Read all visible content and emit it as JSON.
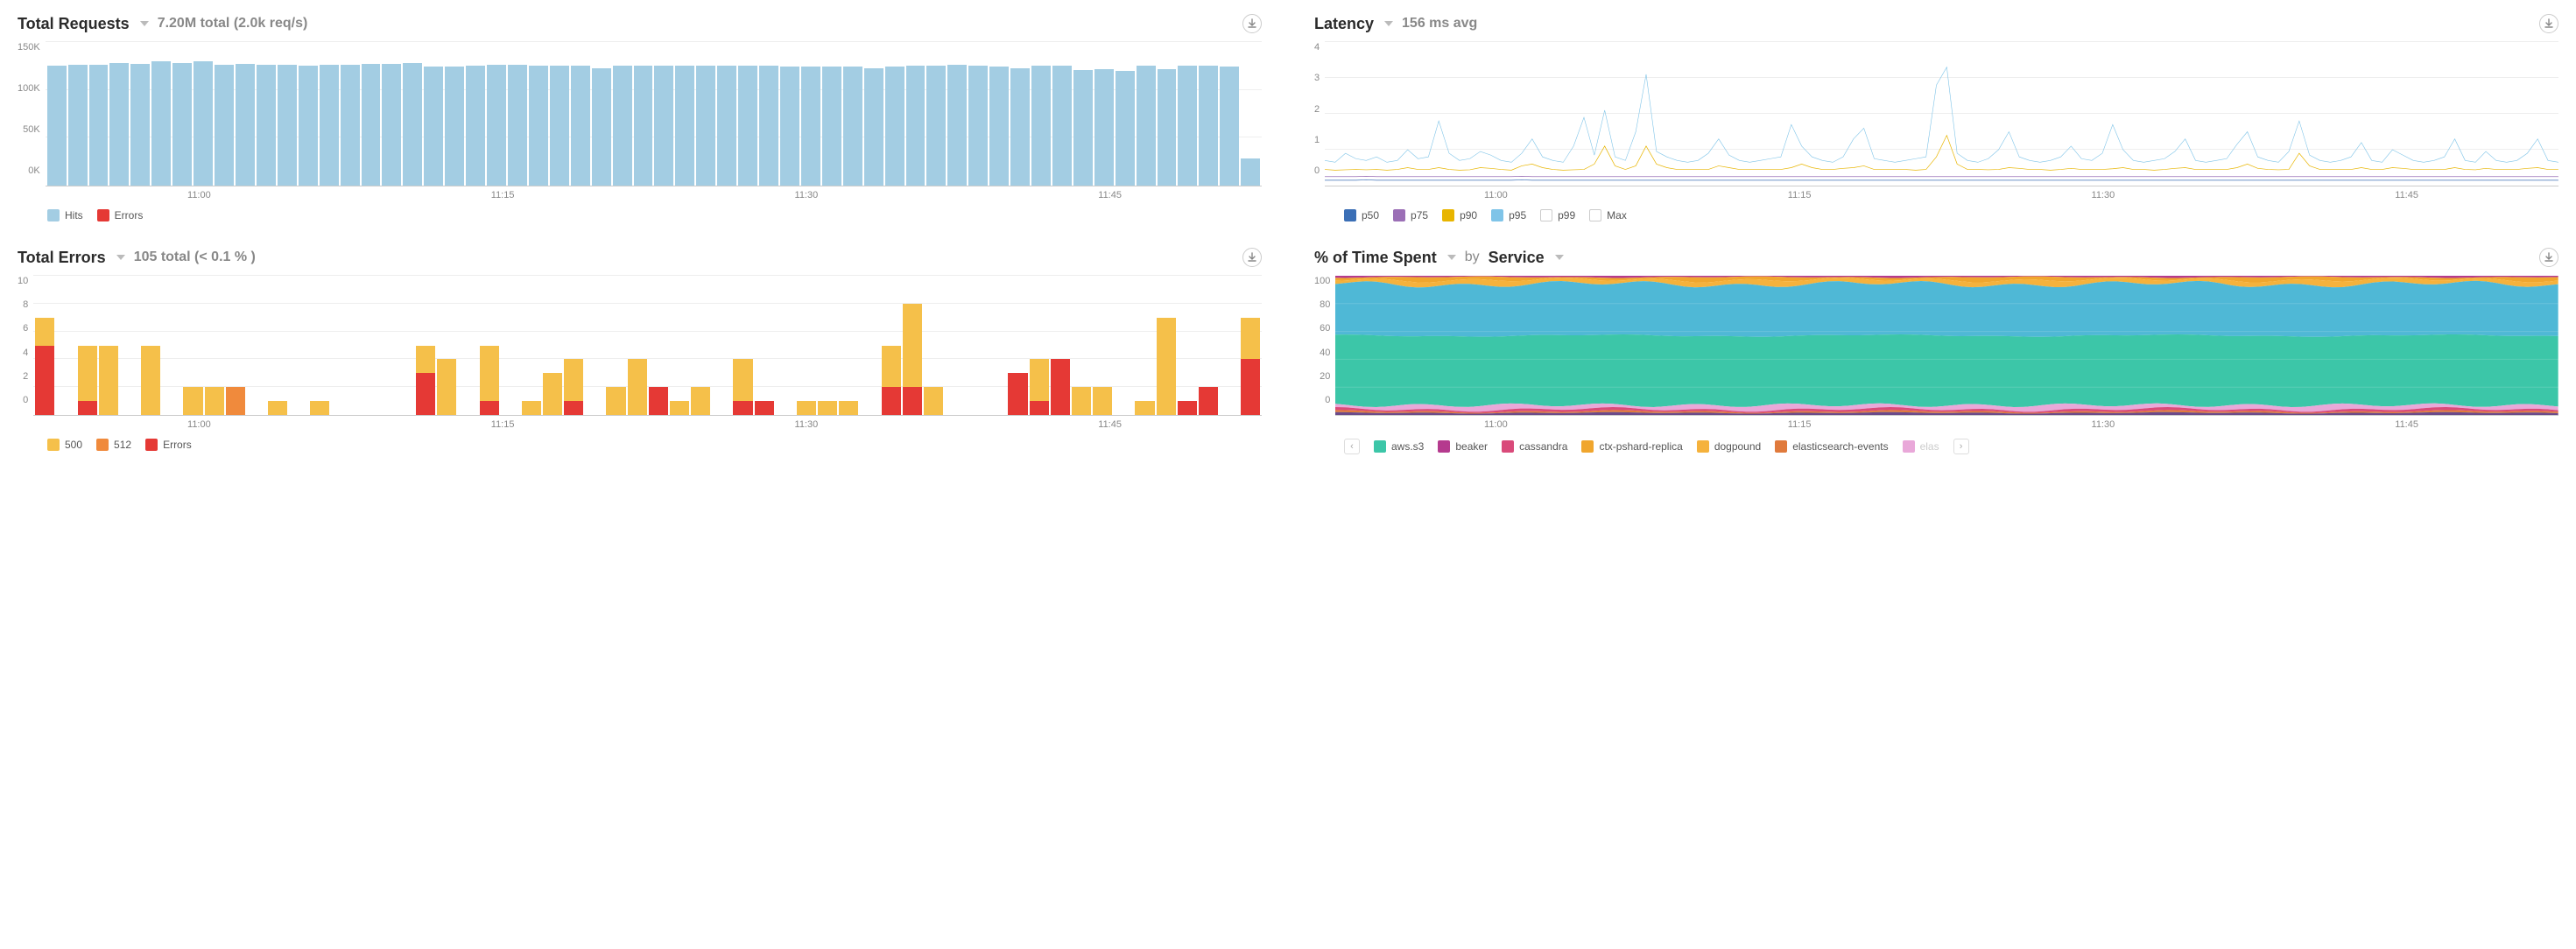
{
  "panels": {
    "requests": {
      "title": "Total Requests",
      "summary": "7.20M total (2.0k req/s)",
      "y_ticks": [
        "150K",
        "100K",
        "50K",
        "0K"
      ],
      "x_ticks": [
        "11:00",
        "11:15",
        "11:30",
        "11:45"
      ],
      "legend": [
        {
          "label": "Hits",
          "color": "#a3cde3"
        },
        {
          "label": "Errors",
          "color": "#e53935"
        }
      ]
    },
    "latency": {
      "title": "Latency",
      "summary": "156 ms avg",
      "y_ticks": [
        "4",
        "3",
        "2",
        "1",
        "0"
      ],
      "x_ticks": [
        "11:00",
        "11:15",
        "11:30",
        "11:45"
      ],
      "legend": [
        {
          "label": "p50",
          "color": "#3b6fb6"
        },
        {
          "label": "p75",
          "color": "#9b6fb6"
        },
        {
          "label": "p90",
          "color": "#e8b500"
        },
        {
          "label": "p95",
          "color": "#7fc4e8"
        },
        {
          "label": "p99",
          "color": "hollow"
        },
        {
          "label": "Max",
          "color": "hollow"
        }
      ]
    },
    "errors": {
      "title": "Total Errors",
      "summary": "105 total (< 0.1 % )",
      "y_ticks": [
        "10",
        "8",
        "6",
        "4",
        "2",
        "0"
      ],
      "x_ticks": [
        "11:00",
        "11:15",
        "11:30",
        "11:45"
      ],
      "legend": [
        {
          "label": "500",
          "color": "#f5c04a"
        },
        {
          "label": "512",
          "color": "#f08a3c"
        },
        {
          "label": "Errors",
          "color": "#e53935"
        }
      ]
    },
    "timespent": {
      "title": "% of Time Spent",
      "by_label": "by",
      "group_label": "Service",
      "y_ticks": [
        "100",
        "80",
        "60",
        "40",
        "20",
        "0"
      ],
      "x_ticks": [
        "11:00",
        "11:15",
        "11:30",
        "11:45"
      ],
      "legend": [
        {
          "label": "aws.s3",
          "color": "#3cc6a8"
        },
        {
          "label": "beaker",
          "color": "#b53a8e"
        },
        {
          "label": "cassandra",
          "color": "#d94a7a"
        },
        {
          "label": "ctx-pshard-replica",
          "color": "#f0a62e"
        },
        {
          "label": "dogpound",
          "color": "#f5b23c"
        },
        {
          "label": "elasticsearch-events",
          "color": "#e07a3c"
        },
        {
          "label": "elas",
          "color": "#e9a8d9",
          "fade": true
        }
      ]
    }
  },
  "chart_data": [
    {
      "id": "requests",
      "type": "bar",
      "title": "Total Requests",
      "subtitle": "7.20M total (2.0k req/s)",
      "xlabel": "",
      "ylabel": "",
      "ylim": [
        0,
        150000
      ],
      "x_tick_labels": [
        "11:00",
        "11:15",
        "11:30",
        "11:45"
      ],
      "n_bars": 58,
      "series": [
        {
          "name": "Hits",
          "color": "#a3cde3",
          "values": [
            125000,
            126000,
            126000,
            128000,
            127000,
            130000,
            128000,
            130000,
            126000,
            127000,
            126000,
            126000,
            125000,
            126000,
            126000,
            127000,
            127000,
            128000,
            124000,
            124000,
            125000,
            126000,
            126000,
            125000,
            125000,
            125000,
            123000,
            125000,
            125000,
            125000,
            125000,
            125000,
            125000,
            125000,
            125000,
            124000,
            124000,
            124000,
            124000,
            123000,
            124000,
            125000,
            125000,
            126000,
            125000,
            124000,
            123000,
            125000,
            125000,
            121000,
            122000,
            120000,
            125000,
            122000,
            125000,
            125000,
            124000,
            28000
          ]
        },
        {
          "name": "Errors",
          "color": "#e53935",
          "values": [
            0,
            0,
            0,
            0,
            0,
            0,
            0,
            0,
            0,
            0,
            0,
            0,
            0,
            0,
            0,
            0,
            0,
            0,
            0,
            0,
            0,
            0,
            0,
            0,
            0,
            0,
            0,
            0,
            0,
            0,
            0,
            0,
            0,
            0,
            0,
            0,
            0,
            0,
            0,
            0,
            0,
            0,
            0,
            0,
            0,
            0,
            0,
            0,
            0,
            0,
            0,
            0,
            0,
            0,
            0,
            0,
            0,
            0
          ]
        }
      ]
    },
    {
      "id": "latency",
      "type": "line",
      "title": "Latency",
      "subtitle": "156 ms avg",
      "xlabel": "",
      "ylabel": "",
      "ylim": [
        0,
        4
      ],
      "x_tick_labels": [
        "11:00",
        "11:15",
        "11:30",
        "11:45"
      ],
      "n_points": 120,
      "series": [
        {
          "name": "p50",
          "color": "#3b6fb6",
          "values": [
            0.15,
            0.15,
            0.15,
            0.15,
            0.16,
            0.15,
            0.15,
            0.15,
            0.15,
            0.15,
            0.15,
            0.15,
            0.15,
            0.15,
            0.15,
            0.15,
            0.15,
            0.15,
            0.15,
            0.16,
            0.15,
            0.15,
            0.15,
            0.15,
            0.15,
            0.15,
            0.15,
            0.15,
            0.15,
            0.15,
            0.15,
            0.15,
            0.15,
            0.15,
            0.15,
            0.15,
            0.15,
            0.15,
            0.15,
            0.15,
            0.15,
            0.15,
            0.15,
            0.15,
            0.15,
            0.15,
            0.15,
            0.15,
            0.15,
            0.15,
            0.15,
            0.15,
            0.15,
            0.15,
            0.15,
            0.15,
            0.15,
            0.15,
            0.15,
            0.15,
            0.15,
            0.15,
            0.15,
            0.15,
            0.15,
            0.15,
            0.15,
            0.15,
            0.15,
            0.15,
            0.15,
            0.15,
            0.15,
            0.15,
            0.15,
            0.15,
            0.15,
            0.15,
            0.15,
            0.15,
            0.15,
            0.15,
            0.15,
            0.15,
            0.15,
            0.15,
            0.15,
            0.15,
            0.15,
            0.15,
            0.15,
            0.15,
            0.15,
            0.15,
            0.15,
            0.15,
            0.15,
            0.15,
            0.15,
            0.15,
            0.15,
            0.15,
            0.15,
            0.15,
            0.15,
            0.15,
            0.15,
            0.15,
            0.15,
            0.15,
            0.15,
            0.15,
            0.15,
            0.15,
            0.15,
            0.15,
            0.15,
            0.15,
            0.15,
            0.15
          ]
        },
        {
          "name": "p75",
          "color": "#9b6fb6",
          "values": [
            0.25,
            0.25,
            0.25,
            0.25,
            0.26,
            0.25,
            0.25,
            0.25,
            0.25,
            0.25,
            0.25,
            0.25,
            0.25,
            0.25,
            0.25,
            0.25,
            0.25,
            0.25,
            0.25,
            0.26,
            0.25,
            0.25,
            0.25,
            0.25,
            0.25,
            0.25,
            0.25,
            0.25,
            0.25,
            0.25,
            0.25,
            0.25,
            0.25,
            0.25,
            0.25,
            0.25,
            0.25,
            0.25,
            0.25,
            0.25,
            0.25,
            0.25,
            0.25,
            0.25,
            0.25,
            0.25,
            0.25,
            0.25,
            0.25,
            0.25,
            0.25,
            0.25,
            0.25,
            0.25,
            0.25,
            0.25,
            0.25,
            0.25,
            0.25,
            0.25,
            0.25,
            0.25,
            0.25,
            0.25,
            0.25,
            0.25,
            0.25,
            0.25,
            0.25,
            0.25,
            0.25,
            0.25,
            0.25,
            0.25,
            0.25,
            0.25,
            0.25,
            0.25,
            0.25,
            0.25,
            0.25,
            0.25,
            0.25,
            0.25,
            0.25,
            0.25,
            0.25,
            0.25,
            0.25,
            0.25,
            0.25,
            0.25,
            0.25,
            0.25,
            0.25,
            0.25,
            0.25,
            0.25,
            0.25,
            0.25,
            0.25,
            0.25,
            0.25,
            0.25,
            0.25,
            0.25,
            0.25,
            0.25,
            0.25,
            0.25,
            0.25,
            0.25,
            0.25,
            0.25,
            0.25,
            0.25,
            0.25,
            0.25,
            0.25,
            0.25
          ]
        },
        {
          "name": "p90",
          "color": "#e8b500",
          "values": [
            0.45,
            0.43,
            0.44,
            0.45,
            0.44,
            0.45,
            0.43,
            0.45,
            0.5,
            0.45,
            0.45,
            0.5,
            0.45,
            0.43,
            0.44,
            0.5,
            0.48,
            0.45,
            0.43,
            0.55,
            0.6,
            0.5,
            0.45,
            0.43,
            0.44,
            0.45,
            0.6,
            1.1,
            0.55,
            0.45,
            0.55,
            1.1,
            0.6,
            0.5,
            0.45,
            0.45,
            0.45,
            0.45,
            0.55,
            0.5,
            0.45,
            0.45,
            0.45,
            0.45,
            0.45,
            0.5,
            0.6,
            0.5,
            0.45,
            0.45,
            0.48,
            0.5,
            0.55,
            0.45,
            0.45,
            0.45,
            0.45,
            0.43,
            0.45,
            0.8,
            1.4,
            0.6,
            0.45,
            0.45,
            0.44,
            0.45,
            0.5,
            0.48,
            0.45,
            0.45,
            0.43,
            0.45,
            0.48,
            0.45,
            0.45,
            0.45,
            0.47,
            0.5,
            0.45,
            0.45,
            0.43,
            0.45,
            0.48,
            0.5,
            0.45,
            0.45,
            0.45,
            0.45,
            0.5,
            0.6,
            0.48,
            0.45,
            0.44,
            0.45,
            0.9,
            0.55,
            0.45,
            0.45,
            0.45,
            0.45,
            0.5,
            0.45,
            0.45,
            0.5,
            0.48,
            0.45,
            0.45,
            0.45,
            0.45,
            0.5,
            0.45,
            0.44,
            0.48,
            0.45,
            0.45,
            0.45,
            0.48,
            0.5,
            0.45,
            0.45
          ]
        },
        {
          "name": "p95",
          "color": "#7fc4e8",
          "values": [
            0.7,
            0.65,
            0.9,
            0.75,
            0.7,
            0.8,
            0.65,
            0.7,
            1.0,
            0.75,
            0.8,
            1.8,
            0.9,
            0.7,
            0.75,
            0.95,
            0.85,
            0.7,
            0.65,
            0.9,
            1.3,
            0.8,
            0.7,
            0.65,
            1.1,
            1.9,
            0.85,
            2.1,
            0.8,
            0.7,
            1.5,
            3.1,
            0.95,
            0.8,
            0.7,
            0.65,
            0.7,
            0.9,
            1.3,
            0.85,
            0.7,
            0.65,
            0.7,
            0.75,
            0.8,
            1.7,
            1.1,
            0.8,
            0.7,
            0.65,
            0.8,
            1.3,
            1.6,
            0.75,
            0.7,
            0.65,
            0.7,
            0.75,
            0.8,
            2.8,
            3.3,
            0.9,
            0.7,
            0.65,
            0.75,
            1.0,
            1.5,
            0.8,
            0.7,
            0.65,
            0.7,
            0.8,
            1.1,
            0.75,
            0.7,
            0.9,
            1.7,
            1.0,
            0.7,
            0.65,
            0.7,
            0.75,
            0.95,
            1.3,
            0.7,
            0.65,
            0.7,
            0.75,
            1.15,
            1.5,
            0.8,
            0.7,
            0.65,
            0.95,
            1.8,
            0.85,
            0.7,
            0.65,
            0.7,
            0.8,
            1.2,
            0.7,
            0.65,
            1.0,
            0.85,
            0.7,
            0.65,
            0.7,
            0.8,
            1.3,
            0.7,
            0.65,
            0.95,
            0.7,
            0.65,
            0.7,
            0.9,
            1.3,
            0.7,
            0.65
          ]
        }
      ]
    },
    {
      "id": "errors",
      "type": "bar",
      "stacked": true,
      "title": "Total Errors",
      "subtitle": "105 total (< 0.1 %)",
      "xlabel": "",
      "ylabel": "",
      "ylim": [
        0,
        10
      ],
      "x_tick_labels": [
        "11:00",
        "11:15",
        "11:30",
        "11:45"
      ],
      "n_bars": 58,
      "series": [
        {
          "name": "Errors",
          "color": "#e53935",
          "values": [
            5,
            0,
            1,
            0,
            0,
            0,
            0,
            0,
            0,
            0,
            0,
            0,
            0,
            0,
            0,
            0,
            0,
            0,
            3,
            0,
            0,
            1,
            0,
            0,
            0,
            1,
            0,
            0,
            0,
            2,
            0,
            0,
            0,
            1,
            1,
            0,
            0,
            0,
            0,
            0,
            2,
            2,
            0,
            0,
            0,
            0,
            3,
            1,
            4,
            0,
            0,
            0,
            0,
            0,
            1,
            2,
            0,
            4
          ]
        },
        {
          "name": "512",
          "color": "#f08a3c",
          "values": [
            0,
            0,
            0,
            0,
            0,
            0,
            0,
            0,
            0,
            2,
            0,
            0,
            0,
            0,
            0,
            0,
            0,
            0,
            0,
            0,
            0,
            0,
            0,
            0,
            0,
            0,
            0,
            0,
            0,
            0,
            0,
            0,
            0,
            0,
            0,
            0,
            0,
            0,
            0,
            0,
            0,
            0,
            0,
            0,
            0,
            0,
            0,
            0,
            0,
            0,
            0,
            0,
            0,
            0,
            0,
            0,
            0,
            0
          ]
        },
        {
          "name": "500",
          "color": "#f5c04a",
          "values": [
            2,
            0,
            4,
            5,
            0,
            5,
            0,
            2,
            2,
            0,
            0,
            1,
            0,
            1,
            0,
            0,
            0,
            0,
            2,
            4,
            0,
            4,
            0,
            1,
            3,
            3,
            0,
            2,
            4,
            0,
            1,
            2,
            0,
            3,
            0,
            0,
            1,
            1,
            1,
            0,
            3,
            6,
            2,
            0,
            0,
            0,
            0,
            3,
            0,
            2,
            2,
            0,
            1,
            7,
            0,
            0,
            0,
            3
          ]
        }
      ]
    },
    {
      "id": "timespent",
      "type": "area",
      "stacked": true,
      "title": "% of Time Spent by Service",
      "xlabel": "",
      "ylabel": "",
      "ylim": [
        0,
        100
      ],
      "x_tick_labels": [
        "11:00",
        "11:15",
        "11:30",
        "11:45"
      ],
      "approx_percent_share": {
        "aws.s3": 50,
        "other-teal-light": 37,
        "dogpound": 5,
        "ctx-pshard-replica": 2,
        "elasticsearch-events": 1,
        "elas-pink": 3,
        "cassandra": 1,
        "beaker": 1
      }
    }
  ]
}
